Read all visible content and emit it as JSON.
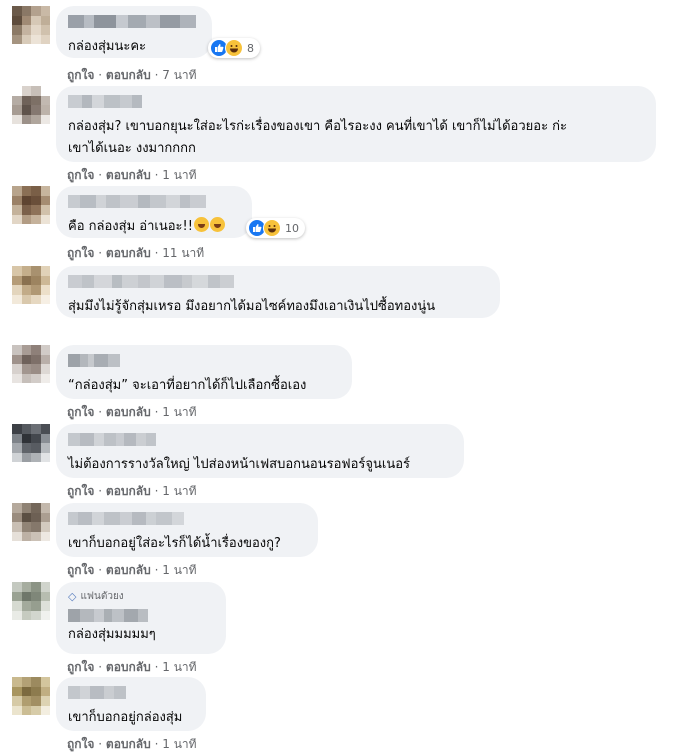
{
  "actions": {
    "like": "ถูกใจ",
    "reply": "ตอบกลับ",
    "sep": "·"
  },
  "comments": [
    {
      "text": "กล่องสุ่มนะคะ",
      "time": "7 นาที",
      "reaction_count": "8"
    },
    {
      "text": "กล่องสุ่ม? เขาบอกยุนะใส่อะไรก่ะเรื่องของเขา คือไรอะงง คนที่เขาได้ เขาก็ไม่ได้อวยอะ ก่ะ\nเขาได้เนอะ งงมากกกก",
      "time": "1 นาที"
    },
    {
      "text": "คือ กล่องสุ่ม อ่าเนอะ!!",
      "time": "11 นาที",
      "reaction_count": "10"
    },
    {
      "text": "สุ่มมึงไม่รู้จักสุ่มเหรอ มึงอยากได้มอไซค์ทองมึงเอาเงินไปซื้อทองนู่น",
      "time": "1 นาที"
    },
    {
      "text": "“กล่องสุ่ม” จะเอาที่อยากได้ก็ไปเลือกซื้อเอง",
      "time": "1 นาที"
    },
    {
      "text": "ไม่ต้องการรางวัลใหญ่ ไปส่องหน้าเฟสบอกนอนรอฟอร์จูนเนอร์",
      "time": "1 นาที"
    },
    {
      "text": "เขาก็บอกอยู่ใส่อะไรก็ได้น้ำเรื่องของกู?",
      "time": "1 นาที"
    },
    {
      "badge": "แฟนตัวยง",
      "text": "กล่องสุ่มมมมมๆ",
      "time": "1 นาที"
    },
    {
      "text": "เขาก็บอกอยู่กล่องสุ่ม",
      "time": "1 นาที"
    }
  ],
  "colors": {
    "bubble": "#f0f2f5",
    "meta_text": "#65676b",
    "like_blue": "#1877f2",
    "haha_yellow": "#f7c23b"
  }
}
